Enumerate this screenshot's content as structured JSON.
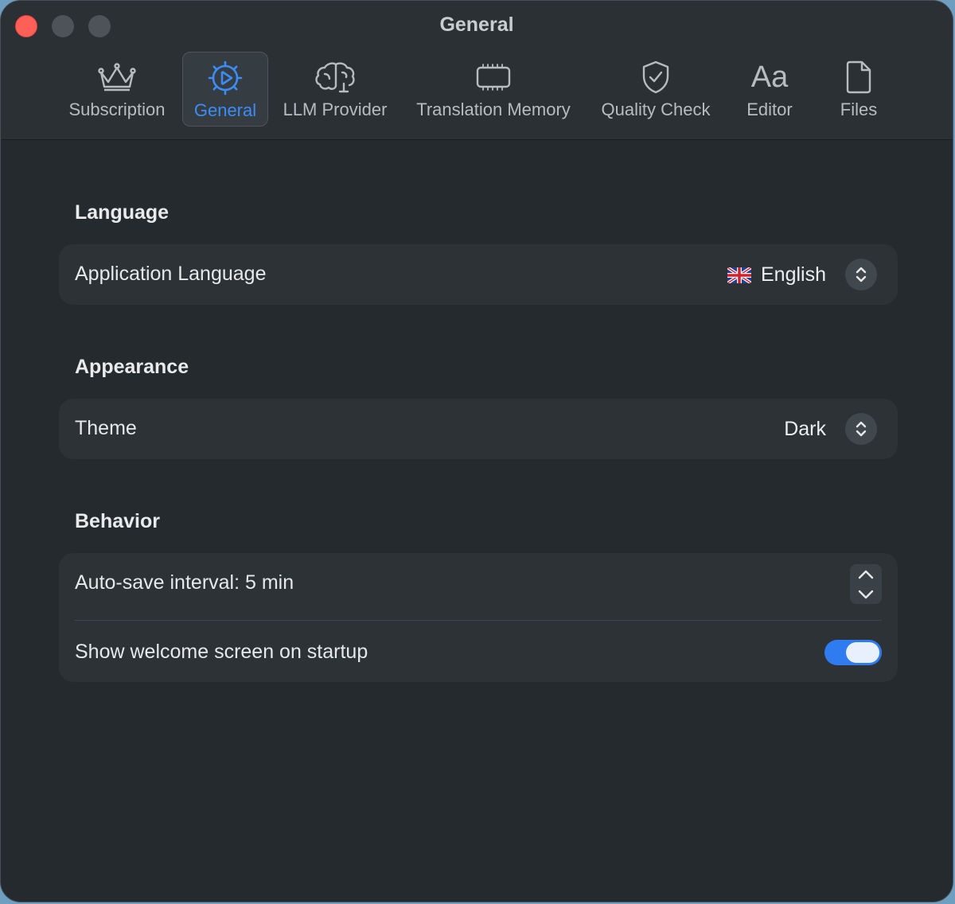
{
  "window": {
    "title": "General"
  },
  "toolbar": {
    "tabs": [
      {
        "label": "Subscription",
        "icon": "crown-icon"
      },
      {
        "label": "General",
        "icon": "gear-icon",
        "active": true
      },
      {
        "label": "LLM Provider",
        "icon": "brain-icon"
      },
      {
        "label": "Translation Memory",
        "icon": "memory-chip-icon"
      },
      {
        "label": "Quality Check",
        "icon": "shield-check-icon"
      },
      {
        "label": "Editor",
        "icon": "text-format-icon",
        "glyph": "Aa"
      },
      {
        "label": "Files",
        "icon": "document-icon"
      }
    ]
  },
  "language": {
    "title": "Language",
    "app_language_label": "Application Language",
    "app_language_value": "English",
    "flag_icon": "uk-flag-icon"
  },
  "appearance": {
    "title": "Appearance",
    "theme_label": "Theme",
    "theme_value": "Dark"
  },
  "behavior": {
    "title": "Behavior",
    "autosave_label": "Auto-save interval: 5 min",
    "welcome_label": "Show welcome screen on startup",
    "welcome_enabled": true
  },
  "colors": {
    "accent": "#3b8cf7",
    "toggle_on": "#2f7bf0",
    "window_bg": "#242a2e",
    "card_bg": "#2c3236"
  }
}
